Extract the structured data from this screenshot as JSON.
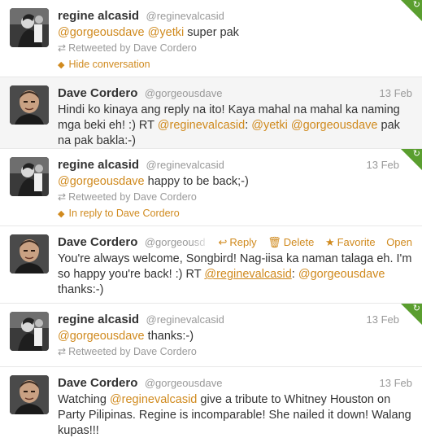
{
  "colors": {
    "link": "#d08a1e",
    "retweet_corner": "#5a9e2f",
    "favorite_star": "#f3c40c",
    "muted": "#999999"
  },
  "tweets": [
    {
      "fullname": "regine alcasid",
      "username": "@reginevalcasid",
      "time": "",
      "mentions": [
        "@gorgeousdave",
        "@yetki"
      ],
      "text_rest": " super pak",
      "retweeted_by": "Retweeted by Dave Cordero",
      "link_label": "Hide conversation",
      "avatar_icon": "bw-photo-avatar"
    },
    {
      "fullname": "Dave Cordero",
      "username": "@gorgeousdave",
      "time": "13 Feb",
      "text_part1": "Hindi ko kinaya ang reply na ito! Kaya mahal na mahal ka naming mga beki eh! :) RT ",
      "mention1": "@reginevalcasid",
      "text_part2": ": ",
      "mention2": "@yetki",
      "text_part3": " ",
      "mention3": "@gorgeousdave",
      "text_part4": " pak na pak bakla:-)",
      "avatar_icon": "bald-man-avatar"
    },
    {
      "fullname": "regine alcasid",
      "username": "@reginevalcasid",
      "time": "13 Feb",
      "mention1": "@gorgeousdave",
      "text_rest": " happy to be back;-)",
      "retweeted_by": "Retweeted by Dave Cordero",
      "link_label": "In reply to Dave Cordero",
      "avatar_icon": "bw-photo-avatar"
    },
    {
      "fullname": "Dave Cordero",
      "username": "@gorgeousda",
      "actions": {
        "reply": "Reply",
        "delete": "Delete",
        "favorite": "Favorite",
        "open": "Open"
      },
      "text_part1": "You're always welcome, Songbird! Nag-iisa ka naman talaga eh. I'm so happy you're back! :) RT ",
      "mention1": "@reginevalcasid",
      "text_part2": ": ",
      "mention2": "@gorgeousdave",
      "text_part3": " thanks:-)",
      "avatar_icon": "bald-man-avatar"
    },
    {
      "fullname": "regine alcasid",
      "username": "@reginevalcasid",
      "time": "13 Feb",
      "mention1": "@gorgeousdave",
      "text_rest": " thanks:-)",
      "retweeted_by": "Retweeted by Dave Cordero",
      "avatar_icon": "bw-photo-avatar"
    },
    {
      "fullname": "Dave Cordero",
      "username": "@gorgeousdave",
      "time": "13 Feb",
      "text_part1": "Watching ",
      "mention1": "@reginevalcasid",
      "text_part2": " give a tribute to Whitney Houston on Party Pilipinas. Regine is incomparable! She nailed it down! Walang kupas!!!",
      "avatar_icon": "bald-man-avatar"
    }
  ]
}
